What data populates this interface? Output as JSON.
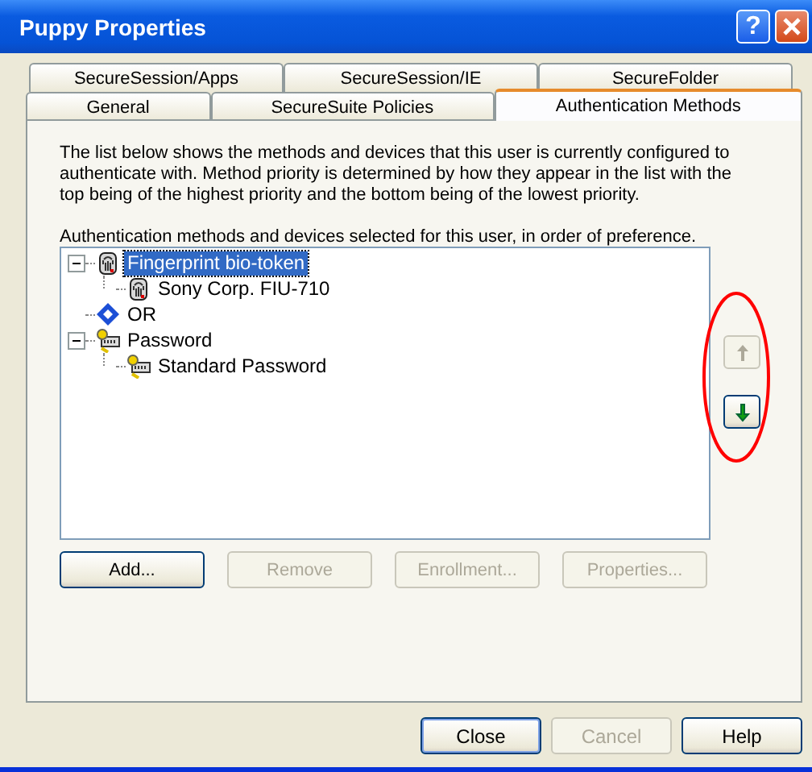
{
  "window": {
    "title": "Puppy Properties",
    "help_glyph": "?"
  },
  "tab_rows": [
    {
      "tabs": [
        {
          "label": "SecureSession/Apps",
          "selected": false
        },
        {
          "label": "SecureSession/IE",
          "selected": false
        },
        {
          "label": "SecureFolder",
          "selected": false
        }
      ]
    },
    {
      "tabs": [
        {
          "label": "General",
          "selected": false
        },
        {
          "label": "SecureSuite Policies",
          "selected": false
        },
        {
          "label": "Authentication Methods",
          "selected": true
        }
      ]
    }
  ],
  "description": "The list below shows the methods and devices that this user is currently configured to authenticate with. Method priority is determined by how they appear in the list with the top being of the highest priority and the bottom being of the lowest priority.",
  "list_label": "Authentication methods and devices selected for this user, in order of preference.",
  "tree": [
    {
      "label": "Fingerprint bio-token",
      "kind": "fingerprint",
      "selected": true,
      "expanded": true,
      "children": [
        {
          "label": "Sony Corp. FIU-710",
          "kind": "fingerprint",
          "selected": false
        }
      ]
    },
    {
      "label": "OR",
      "kind": "or",
      "selected": false
    },
    {
      "label": "Password",
      "kind": "password",
      "selected": false,
      "expanded": true,
      "children": [
        {
          "label": "Standard Password",
          "kind": "password",
          "selected": false
        }
      ]
    }
  ],
  "move_buttons": [
    {
      "kind": "up",
      "disabled": true
    },
    {
      "kind": "down",
      "disabled": false
    }
  ],
  "annotation": {
    "kind": "ellipse"
  },
  "action_buttons": [
    {
      "label": "Add...",
      "disabled": false
    },
    {
      "label": "Remove",
      "disabled": true
    },
    {
      "label": "Enrollment...",
      "disabled": true
    },
    {
      "label": "Properties...",
      "disabled": true
    }
  ],
  "dialog_buttons": [
    {
      "label": "Close",
      "disabled": false,
      "default": true
    },
    {
      "label": "Cancel",
      "disabled": true,
      "default": false
    },
    {
      "label": "Help",
      "disabled": false,
      "default": false
    }
  ]
}
